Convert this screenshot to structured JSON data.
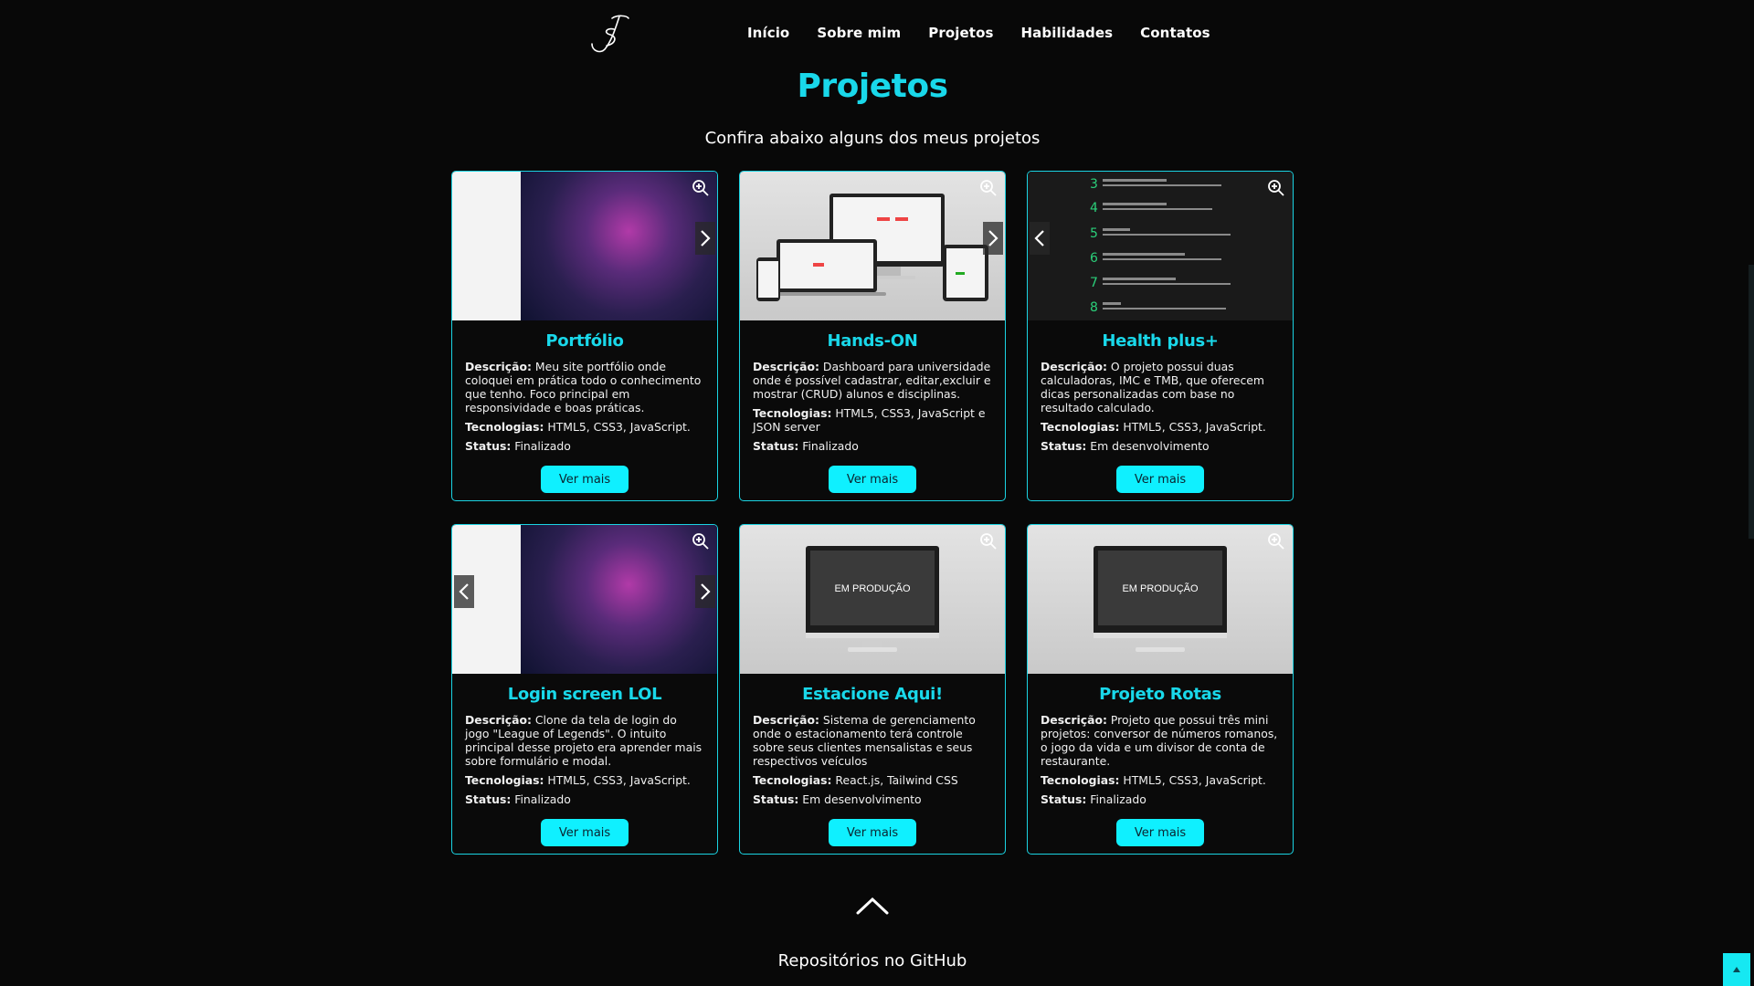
{
  "nav": {
    "items": [
      "Início",
      "Sobre mim",
      "Projetos",
      "Habilidades",
      "Contatos"
    ]
  },
  "section": {
    "title": "Projetos",
    "subtitle": "Confira abaixo alguns dos meus projetos"
  },
  "labels": {
    "descricao": "Descrição:",
    "tecnologias": "Tecnologias:",
    "status": "Status:",
    "button": "Ver mais",
    "monitor": "EM PRODUÇÃO"
  },
  "projects": [
    {
      "title": "Portfólio",
      "description": "Meu site portfólio onde coloquei em prática todo o conhecimento que tenho. Foco principal em responsividade e boas práticas.",
      "tech": "HTML5, CSS3, JavaScript.",
      "status": "Finalizado"
    },
    {
      "title": "Hands-ON",
      "description": "Dashboard para universidade onde é possível cadastrar, editar,excluir e mostrar (CRUD) alunos e disciplinas.",
      "tech": "HTML5, CSS3, JavaScript e JSON server",
      "status": "Finalizado"
    },
    {
      "title": "Health plus+",
      "description": "O projeto possui duas calculadoras, IMC e TMB, que oferecem dicas personalizadas com base no resultado calculado.",
      "tech": "HTML5, CSS3, JavaScript.",
      "status": "Em desenvolvimento"
    },
    {
      "title": "Login screen LOL",
      "description": "Clone da tela de login do jogo \"League of Legends\". O intuito principal desse projeto era aprender mais sobre formulário e modal.",
      "tech": "HTML5, CSS3, JavaScript.",
      "status": "Finalizado"
    },
    {
      "title": "Estacione Aqui!",
      "description": "Sistema de gerenciamento onde o estacionamento terá controle sobre seus clientes mensalistas e seus respectivos veículos",
      "tech": "React.js, Tailwind CSS",
      "status": "Em desenvolvimento"
    },
    {
      "title": "Projeto Rotas",
      "description": "Projeto que possui três mini projetos: conversor de números romanos, o jogo da vida e um divisor de conta de restaurante.",
      "tech": "HTML5, CSS3, JavaScript.",
      "status": "Finalizado"
    }
  ],
  "footer": {
    "github_title": "Repositórios no GitHub"
  },
  "colors": {
    "accent": "#19d8ea",
    "button": "#0ff0ff",
    "background": "#080808"
  }
}
